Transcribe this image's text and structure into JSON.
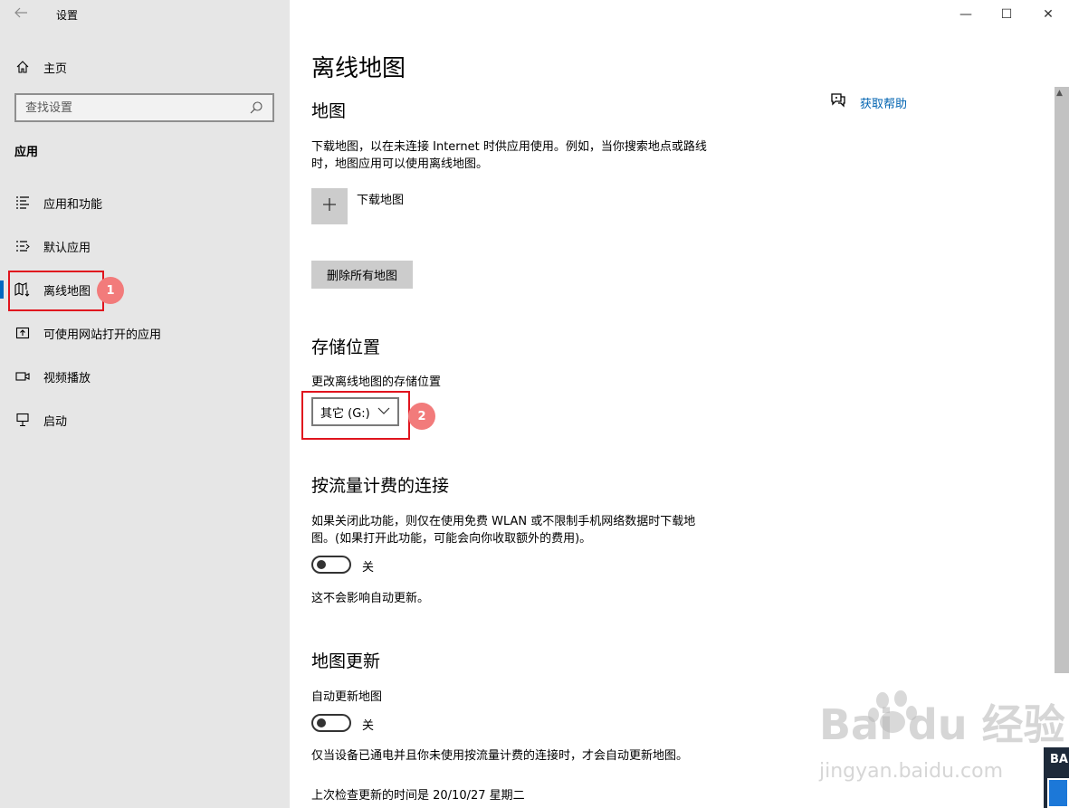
{
  "window": {
    "title": "设置",
    "minimize": "—",
    "maximize": "☐",
    "close": "✕"
  },
  "sidebar": {
    "home_label": "主页",
    "search_placeholder": "查找设置",
    "section_title": "应用",
    "items": [
      {
        "label": "应用和功能",
        "icon": "apps-features-icon"
      },
      {
        "label": "默认应用",
        "icon": "default-apps-icon"
      },
      {
        "label": "离线地图",
        "icon": "offline-maps-icon",
        "active": true
      },
      {
        "label": "可使用网站打开的应用",
        "icon": "apps-websites-icon"
      },
      {
        "label": "视频播放",
        "icon": "video-playback-icon"
      },
      {
        "label": "启动",
        "icon": "startup-icon"
      }
    ]
  },
  "annotations": {
    "badge1": "1",
    "badge2": "2"
  },
  "main": {
    "page_title": "离线地图",
    "help_label": "获取帮助",
    "maps": {
      "heading": "地图",
      "description": "下载地图，以在未连接 Internet 时供应用使用。例如，当你搜索地点或路线时，地图应用可以使用离线地图。",
      "download_label": "下载地图",
      "delete_all_label": "删除所有地图"
    },
    "storage": {
      "heading": "存储位置",
      "label": "更改离线地图的存储位置",
      "selected": "其它 (G:)"
    },
    "metered": {
      "heading": "按流量计费的连接",
      "description": "如果关闭此功能，则仅在使用免费 WLAN 或不限制手机网络数据时下载地图。(如果打开此功能，可能会向你收取额外的费用)。",
      "toggle_state": "关",
      "note": "这不会影响自动更新。"
    },
    "updates": {
      "heading": "地图更新",
      "auto_label": "自动更新地图",
      "toggle_state": "关",
      "note": "仅当设备已通电并且你未使用按流量计费的连接时，才会自动更新地图。",
      "last_checked": "上次检查更新的时间是 20/10/27 星期二"
    }
  },
  "watermark": {
    "brand": "Bai du 经验",
    "url": "jingyan.baidu.com"
  },
  "corner_badge": "BA",
  "colors": {
    "sidebar_bg": "#e6e6e6",
    "accent": "#0067c0",
    "link": "#0063b1",
    "annotation_red": "#e0141e",
    "badge_pink": "#f27b7b"
  }
}
